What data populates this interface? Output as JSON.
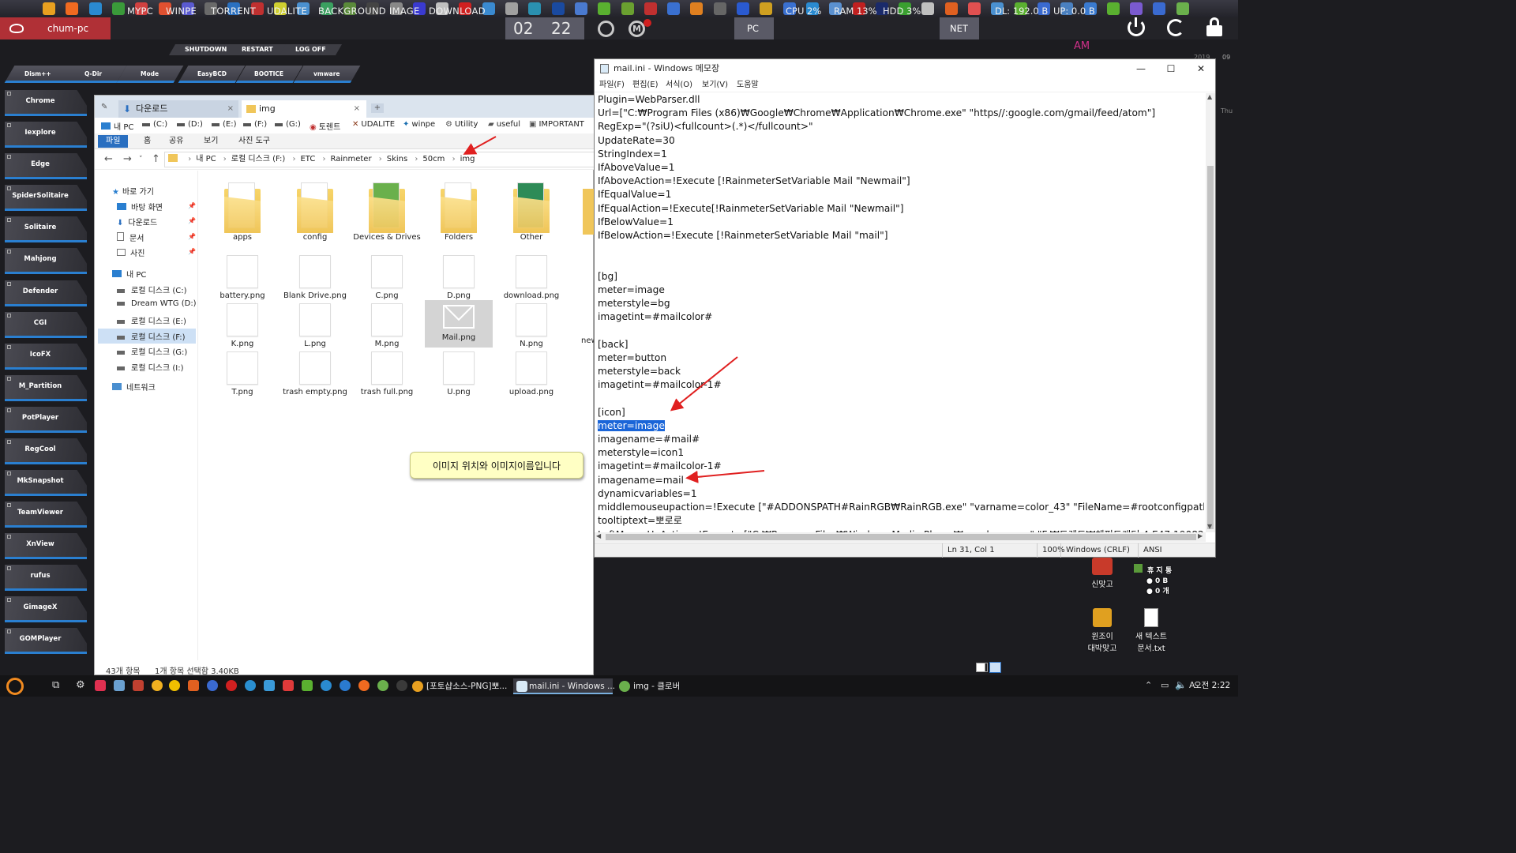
{
  "topbar": {
    "computer_name": "chum-pc",
    "nav": [
      "MYPC",
      "WINPE",
      "TORRENT",
      "UDALITE",
      "BACKGROUND IMAGE",
      "DOWNLOAD"
    ],
    "numbers": [
      "02",
      "22"
    ],
    "stats": {
      "pc": "PC",
      "cpu": "CPU 2%",
      "ram": "RAM 13%",
      "hdd": "HDD 3%",
      "net": "NET",
      "dl": "DL: 192.0 B",
      "up": "UP: 0.0 B"
    },
    "am": "AM",
    "sub_buttons": [
      "SHUTDOWN",
      "RESTART",
      "LOG OFF"
    ],
    "launch_buttons": [
      "Dism++",
      "Q-Dir",
      "Mode",
      "EasyBCD",
      "BOOTICE",
      "vmware"
    ],
    "date_small": "2019",
    "day_small": "09",
    "weekday_small": "Thu"
  },
  "sidebar": {
    "items": [
      "Chrome",
      "Iexplore",
      "Edge",
      "SpiderSolitaire",
      "Solitaire",
      "Mahjong",
      "Defender",
      "CGI",
      "IcoFX",
      "M_Partition",
      "PotPlayer",
      "RegCool",
      "MkSnapshot",
      "TeamViewer",
      "XnView",
      "rufus",
      "GimageX",
      "GOMPlayer"
    ]
  },
  "explorer": {
    "tabs": [
      "다운로드",
      "img"
    ],
    "favorites": [
      "내 PC",
      "(C:)",
      "(D:)",
      "(E:)",
      "(F:)",
      "(G:)",
      "토렌트",
      "UDALITE",
      "winpe",
      "Utility",
      "useful",
      "IMPORTANT"
    ],
    "ribbon": [
      "파일",
      "홈",
      "공유",
      "보기",
      "사진 도구"
    ],
    "path": [
      "내 PC",
      "로컬 디스크 (F:)",
      "ETC",
      "Rainmeter",
      "Skins",
      "50cm",
      "img"
    ],
    "nav_tree": {
      "quick": "바로 가기",
      "quick_items": [
        "바탕 화면",
        "다운로드",
        "문서",
        "사진"
      ],
      "thispc": "내 PC",
      "drives": [
        "로컬 디스크 (C:)",
        "Dream WTG (D:)",
        "로컬 디스크 (E:)",
        "로컬 디스크 (F:)",
        "로컬 디스크 (G:)",
        "로컬 디스크 (I:)"
      ],
      "network": "네트워크"
    },
    "folders": [
      "apps",
      "config",
      "Devices & Drives",
      "Folders",
      "Other"
    ],
    "files_row2": [
      "battery.png",
      "Blank Drive.png",
      "C.png",
      "D.png",
      "download.png"
    ],
    "files_row3": [
      "K.png",
      "L.png",
      "M.png",
      "Mail.png",
      "N.png",
      "new"
    ],
    "files_row4": [
      "T.png",
      "trash empty.png",
      "trash full.png",
      "U.png",
      "upload.png"
    ],
    "status_count": "43개 항목",
    "status_selected": "1개 항목 선택함 3.40KB"
  },
  "notepad": {
    "title": "mail.ini - Windows 메모장",
    "menu": [
      "파일(F)",
      "편집(E)",
      "서식(O)",
      "보기(V)",
      "도움말"
    ],
    "lines": [
      "Plugin=WebParser.dll",
      "Url=[\"C:₩Program Files (x86)₩Google₩Chrome₩Application₩Chrome.exe\" \"https//:google.com/gmail/feed/atom\"]",
      "RegExp=\"(?siU)<fullcount>(.*)</fullcount>\"",
      "UpdateRate=30",
      "StringIndex=1",
      "IfAboveValue=1",
      "IfAboveAction=!Execute [!RainmeterSetVariable Mail \"Newmail\"]",
      "IfEqualValue=1",
      "IfEqualAction=!Execute[!RainmeterSetVariable Mail \"Newmail\"]",
      "IfBelowValue=1",
      "IfBelowAction=!Execute [!RainmeterSetVariable Mail \"mail\"]",
      "",
      "",
      "[bg]",
      "meter=image",
      "meterstyle=bg",
      "imagetint=#mailcolor#",
      "",
      "[back]",
      "meter=button",
      "meterstyle=back",
      "imagetint=#mailcolor-1#",
      "",
      "[icon]",
      "meter=image",
      "imagename=#mail#",
      "meterstyle=icon1",
      "imagetint=#mailcolor-1#",
      "imagename=mail",
      "dynamicvariables=1",
      "middlemouseupaction=!Execute [\"#ADDONSPATH#RainRGB₩RainRGB.exe\" \"varname=color_43\" \"FileName=#rootconfigpath#cc",
      "tooltiptext=뽀로로",
      "LeftMouseUpAction=!Execute [\"C:₩Program Files₩Windows Media Player₩wmplayer.exe\" \"F:₩토렌트₩체피트게더 4 E47 190829"
    ],
    "status": {
      "pos": "Ln 31, Col 1",
      "zoom": "100%",
      "eol": "Windows (CRLF)",
      "enc": "ANSI"
    }
  },
  "callout": "이미지 위치와 이미지이름입니다",
  "desktop": {
    "icon1": "신맞고",
    "icon2_line1": "윈조이",
    "icon2_line2": "대박맞고",
    "icon3_line1": "새 텍스트",
    "icon3_line2": "문서.txt",
    "recycle": "휴 지 통",
    "recycle_size": "0 B",
    "recycle_count": "0 개"
  },
  "taskbar": {
    "items": [
      "[포토샵소스-PNG]뽀...",
      "mail.ini - Windows ...",
      "img - 클로버"
    ],
    "clock": "오전 2:22"
  }
}
